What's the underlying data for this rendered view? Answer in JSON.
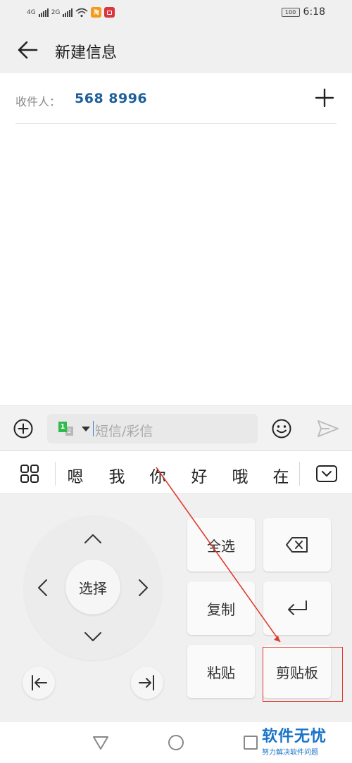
{
  "status_bar": {
    "net1": "4G",
    "net2": "2G",
    "app_icon_1": "淘",
    "battery": "100",
    "time": "6:18"
  },
  "header": {
    "title": "新建信息"
  },
  "recipient": {
    "label": "收件人：",
    "number": "568 8996"
  },
  "compose": {
    "sim_primary": "1",
    "sim_secondary": "2",
    "placeholder": "短信/彩信"
  },
  "candidates": [
    "嗯",
    "我",
    "你",
    "好",
    "哦",
    "在"
  ],
  "dpad": {
    "center_label": "选择"
  },
  "keys": {
    "select_all": "全选",
    "copy": "复制",
    "paste": "粘贴",
    "clipboard": "剪贴板"
  },
  "watermark": {
    "title": "软件无忧",
    "subtitle": "努力解决软件问题"
  },
  "annotation": {
    "color": "#e03a2f"
  },
  "colors": {
    "recipient_number": "#1f5f9b",
    "sim_green": "#2dbb4a",
    "watermark": "#1a73c9"
  }
}
